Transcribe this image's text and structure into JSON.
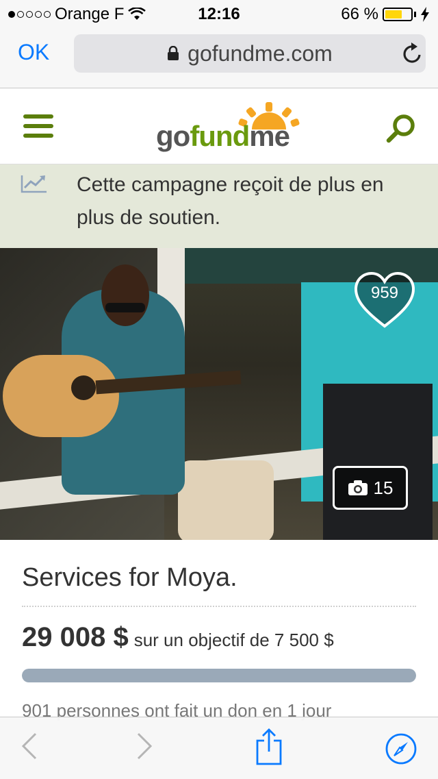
{
  "status_bar": {
    "carrier": "Orange F",
    "signal_strength": 1,
    "time": "12:16",
    "battery_percent": "66 %",
    "battery_level": 0.66
  },
  "browser": {
    "done_label": "OK",
    "url": "gofundme.com",
    "accent_color": "#0a7aff"
  },
  "site_header": {
    "logo": {
      "go": "go",
      "fund": "fund",
      "me": "me"
    },
    "brand_color": "#5b7e0c"
  },
  "trend_banner": {
    "text": "Cette campagne reçoit de plus en plus de soutien."
  },
  "hero": {
    "hearts_count": "959",
    "photo_count": "15"
  },
  "campaign": {
    "title": "Services for Moya.",
    "raised": "29 008 $",
    "goal_text": "sur un objectif de 7 500 $",
    "progress_fraction": 1.0,
    "donors_text": "901 personnes ont fait un don en 1 jour"
  },
  "icons": {
    "menu": "hamburger-menu-icon",
    "search": "search-icon",
    "trend": "trending-up-icon",
    "heart": "heart-icon",
    "camera": "camera-icon",
    "back": "chevron-left-icon",
    "forward": "chevron-right-icon",
    "share": "share-icon",
    "safari": "compass-icon",
    "lock": "lock-icon",
    "reload": "reload-icon",
    "wifi": "wifi-icon",
    "battery": "battery-icon",
    "charging": "lightning-icon"
  }
}
